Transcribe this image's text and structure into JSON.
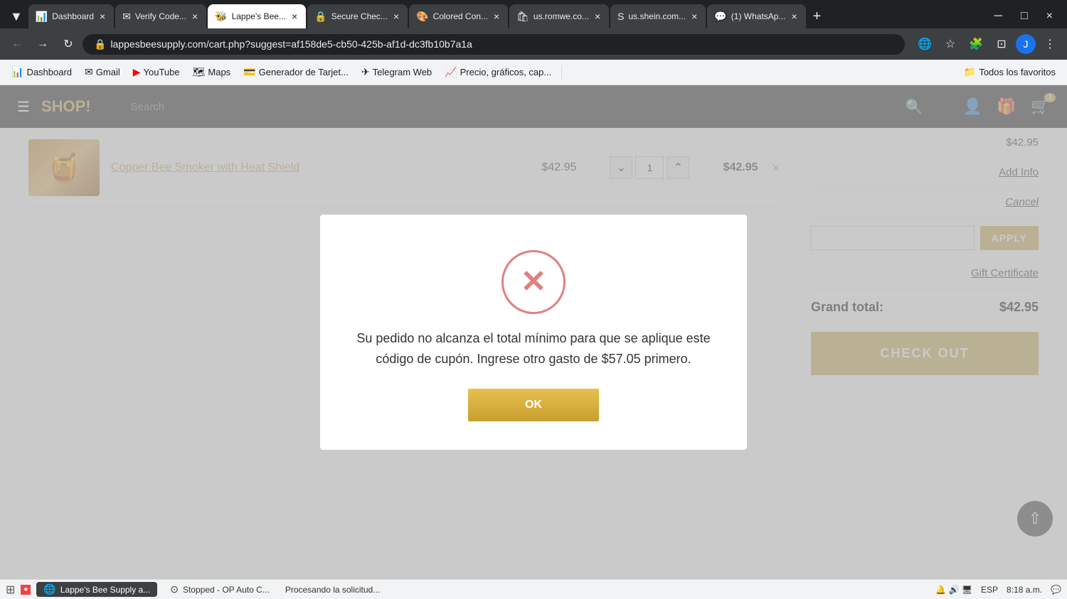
{
  "browser": {
    "tabs": [
      {
        "id": "dashboard",
        "title": "Dashboard",
        "favicon": "📊",
        "active": false,
        "url": ""
      },
      {
        "id": "verify",
        "title": "Verify Code...",
        "favicon": "✉",
        "active": false,
        "url": ""
      },
      {
        "id": "lappes",
        "title": "Lappe's Bee...",
        "favicon": "🐝",
        "active": true,
        "url": ""
      },
      {
        "id": "secure",
        "title": "Secure Chec...",
        "favicon": "🔒",
        "active": false,
        "url": ""
      },
      {
        "id": "colored",
        "title": "Colored Con...",
        "favicon": "🎨",
        "active": false,
        "url": ""
      },
      {
        "id": "romwe",
        "title": "us.romwe.co...",
        "favicon": "🛍",
        "active": false,
        "url": ""
      },
      {
        "id": "shein",
        "title": "us.shein.com...",
        "favicon": "S",
        "active": false,
        "url": ""
      },
      {
        "id": "whatsapp",
        "title": "(1) WhatsAp...",
        "favicon": "💬",
        "active": false,
        "url": ""
      }
    ],
    "address": "lappesbeesupply.com/cart.php?suggest=af158de5-cb50-425b-af1d-dc3fb10b7a1a",
    "bookmarks": [
      {
        "id": "dashboard",
        "label": "Dashboard",
        "icon": "📊"
      },
      {
        "id": "gmail",
        "label": "Gmail",
        "icon": "✉"
      },
      {
        "id": "youtube",
        "label": "YouTube",
        "icon": "▶"
      },
      {
        "id": "maps",
        "label": "Maps",
        "icon": "🗺"
      },
      {
        "id": "tarjetas",
        "label": "Generador de Tarjet...",
        "icon": "💳"
      },
      {
        "id": "telegram",
        "label": "Telegram Web",
        "icon": "✈"
      },
      {
        "id": "precio",
        "label": "Precio, gráficos, cap...",
        "icon": "📈"
      },
      {
        "id": "favoritos",
        "label": "Todos los favoritos",
        "icon": "⭐"
      }
    ]
  },
  "shop": {
    "menu_label": "☰",
    "title": "SHOP!",
    "search_placeholder": "Search",
    "cart_count": "1"
  },
  "cart": {
    "item": {
      "title": "Copper Bee Smoker with Heat Shield",
      "price": "$42.95",
      "quantity": "1",
      "total": "$42.95"
    },
    "subtotal_label": "",
    "subtotal_value": "$42.95",
    "add_info_label": "Add Info",
    "cancel_label": "Cancel",
    "coupon_placeholder": "",
    "apply_label": "APPLY",
    "gift_certificate_label": "Gift Certificate",
    "grand_total_label": "Grand total:",
    "grand_total_value": "$42.95",
    "checkout_label": "CHECK OUT"
  },
  "modal": {
    "message": "Su pedido no alcanza el total mínimo para que se aplique este código de cupón. Ingrese otro gasto de $57.05 primero.",
    "ok_label": "OK"
  },
  "statusbar": {
    "processing_text": "Procesando la solicitud...",
    "taskbar_active": "Lappe's Bee Supply a...",
    "taskbar_stopped": "Stopped - OP Auto C...",
    "system_lang": "ESP",
    "system_time": "8:18 a.m."
  }
}
